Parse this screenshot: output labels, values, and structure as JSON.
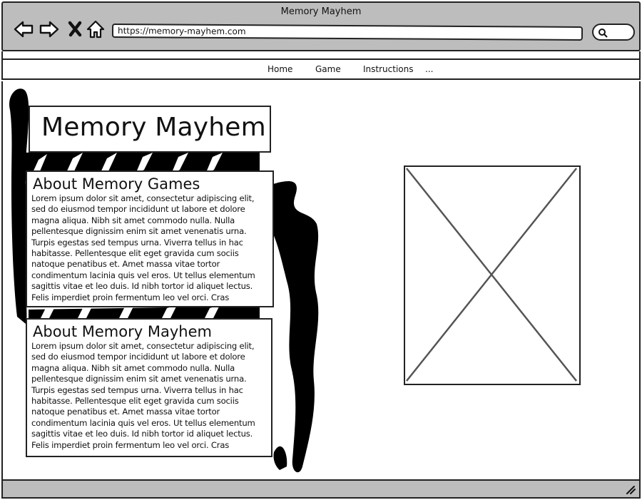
{
  "window": {
    "title": "Memory Mayhem",
    "url": "https://memory-mayhem.com"
  },
  "toolbar": {
    "icons": [
      "back-arrow-icon",
      "forward-arrow-icon",
      "close-icon",
      "home-icon",
      "search-icon"
    ]
  },
  "nav": {
    "items": [
      "Home",
      "Game",
      "Instructions",
      "..."
    ]
  },
  "page": {
    "title": "Memory Mayhem",
    "sections": [
      {
        "heading": "About Memory Games",
        "body": "Lorem ipsum dolor sit amet, consectetur adipiscing elit, sed do eiusmod tempor incididunt ut labore et dolore magna aliqua. Nibh sit amet commodo nulla. Nulla pellentesque dignissim enim sit amet venenatis urna. Turpis egestas sed tempus urna. Viverra tellus in hac habitasse. Pellentesque elit eget gravida cum sociis natoque penatibus et. Amet massa vitae tortor condimentum lacinia quis vel eros. Ut tellus elementum sagittis vitae et leo duis. Id nibh tortor id aliquet lectus. Felis imperdiet proin fermentum leo vel orci. Cras"
      },
      {
        "heading": "About Memory Mayhem",
        "body": "Lorem ipsum dolor sit amet, consectetur adipiscing elit, sed do eiusmod tempor incididunt ut labore et dolore magna aliqua. Nibh sit amet commodo nulla. Nulla pellentesque dignissim enim sit amet venenatis urna. Turpis egestas sed tempus urna. Viverra tellus in hac habitasse. Pellentesque elit eget gravida cum sociis natoque penatibus et. Amet massa vitae tortor condimentum lacinia quis vel eros. Ut tellus elementum sagittis vitae et leo duis. Id nibh tortor id aliquet lectus. Felis imperdiet proin fermentum leo vel orci. Cras"
      }
    ],
    "image": "image-placeholder-icon"
  },
  "colors": {
    "chrome": "#bdbdbd",
    "stroke": "#222222",
    "scribble": "#000000",
    "placeholder_x": "#555555"
  }
}
